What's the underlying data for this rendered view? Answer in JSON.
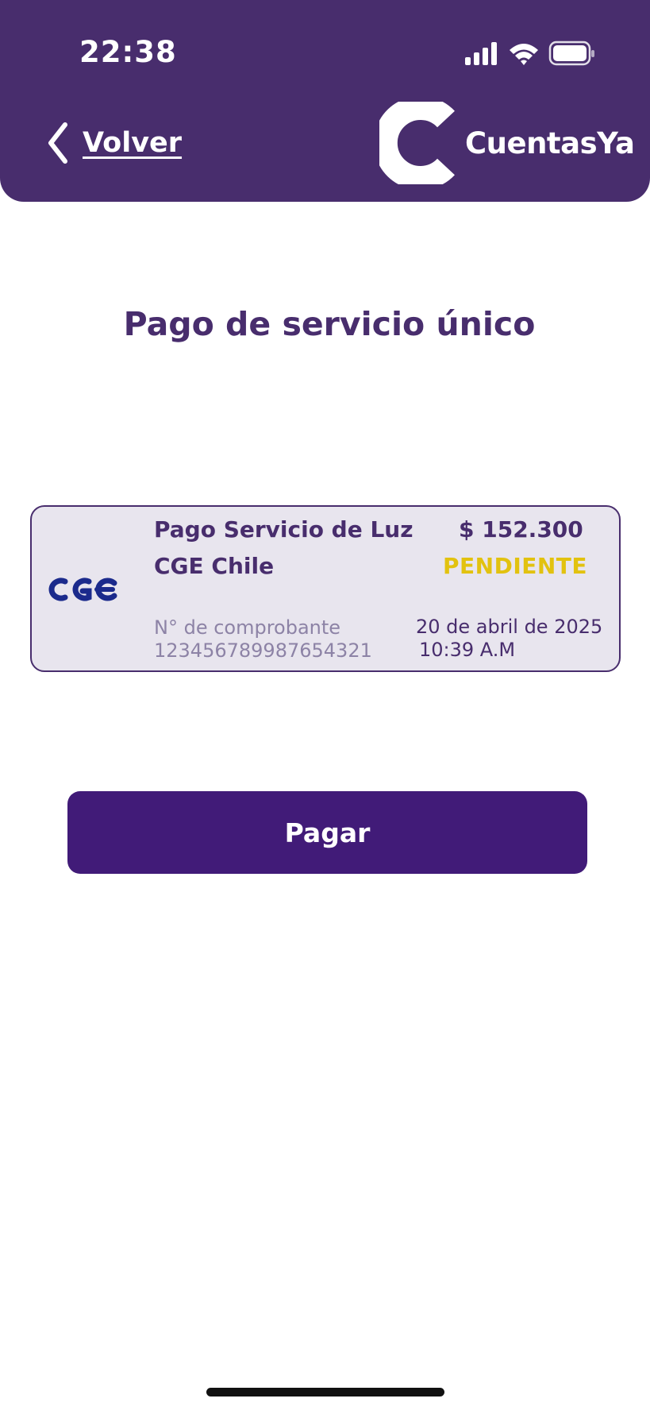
{
  "status_bar": {
    "time": "22:38",
    "icons": [
      "signal-icon",
      "wifi-icon",
      "battery-icon"
    ]
  },
  "header": {
    "back_label": "Volver",
    "brand_name": "CuentasYa",
    "icons": [
      "chevron-left-icon",
      "cuentasya-logo-icon"
    ]
  },
  "page": {
    "title": "Pago de servicio único"
  },
  "payment_card": {
    "logo_icon": "cge-logo-icon",
    "service_name": "Pago Servicio de Luz",
    "provider": "CGE Chile",
    "amount": "$ 152.300",
    "status": "PENDIENTE",
    "voucher_label": "N° de comprobante",
    "voucher_number": "123456789987654321",
    "date": "20 de abril de 2025",
    "time": "10:39 A.M"
  },
  "actions": {
    "pay_label": "Pagar"
  },
  "colors": {
    "brand": "#482d6d",
    "button": "#411b78",
    "card_bg": "#e8e5ee",
    "status_pending": "#e2c20f",
    "muted_text": "#8d83a6"
  }
}
